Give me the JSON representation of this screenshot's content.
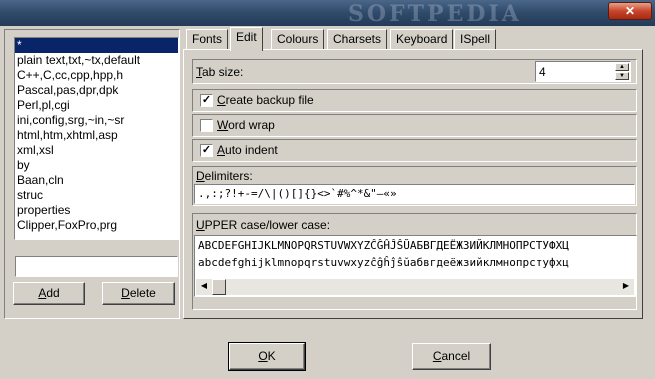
{
  "titlebar": {
    "watermark": "SOFTPEDIA",
    "close_glyph": "✕"
  },
  "filetypes": {
    "items": [
      "*",
      "plain text,txt,~tx,default",
      "C++,C,cc,cpp,hpp,h",
      "Pascal,pas,dpr,dpk",
      "Perl,pl,cgi",
      "ini,config,srg,~in,~sr",
      "html,htm,xhtml,asp",
      "xml,xsl",
      "by",
      "Baan,cln",
      "struc",
      "properties",
      "Clipper,FoxPro,prg"
    ],
    "selected_index": 0,
    "new_value": "",
    "add_label_key": "A",
    "add_label_rest": "dd",
    "delete_label_key": "D",
    "delete_label_rest": "elete"
  },
  "tabs": [
    "Fonts",
    "Edit",
    "Colours",
    "Charsets",
    "Keyboard",
    "ISpell"
  ],
  "active_tab": "Edit",
  "edit": {
    "tab_size_key": "T",
    "tab_size_rest": "ab size:",
    "tab_size_value": "4",
    "backup_key": "C",
    "backup_rest": "reate backup file",
    "backup_checked": "✓",
    "wordwrap_key": "W",
    "wordwrap_rest": "ord wrap",
    "wordwrap_checked": "",
    "autoindent_key": "A",
    "autoindent_rest": "uto indent",
    "autoindent_checked": "✓",
    "delimiters_key": "D",
    "delimiters_rest": "elimiters:",
    "delimiters_value": ".,:;?!+-=/\\|()[]{}<>`#%^*&\"—«»",
    "case_key": "U",
    "case_rest": "PPER case/lower case:",
    "upper_value": "ABCDEFGHIJKLMNOPQRSTUVWXYZĈĜĤĴŜŬАБВГДЕЁЖЗИЙКЛМНОПРСТУФХЦ",
    "lower_value": "abcdefghijklmnopqrstuvwxyzĉĝĥĵŝŭабвгдеёжзийклмнопрстуфхц",
    "scroll_left": "◀",
    "scroll_right": "▶",
    "spin_up": "▲",
    "spin_down": "▼"
  },
  "dialog": {
    "ok_key": "O",
    "ok_rest": "K",
    "cancel_key": "C",
    "cancel_rest": "ancel"
  }
}
